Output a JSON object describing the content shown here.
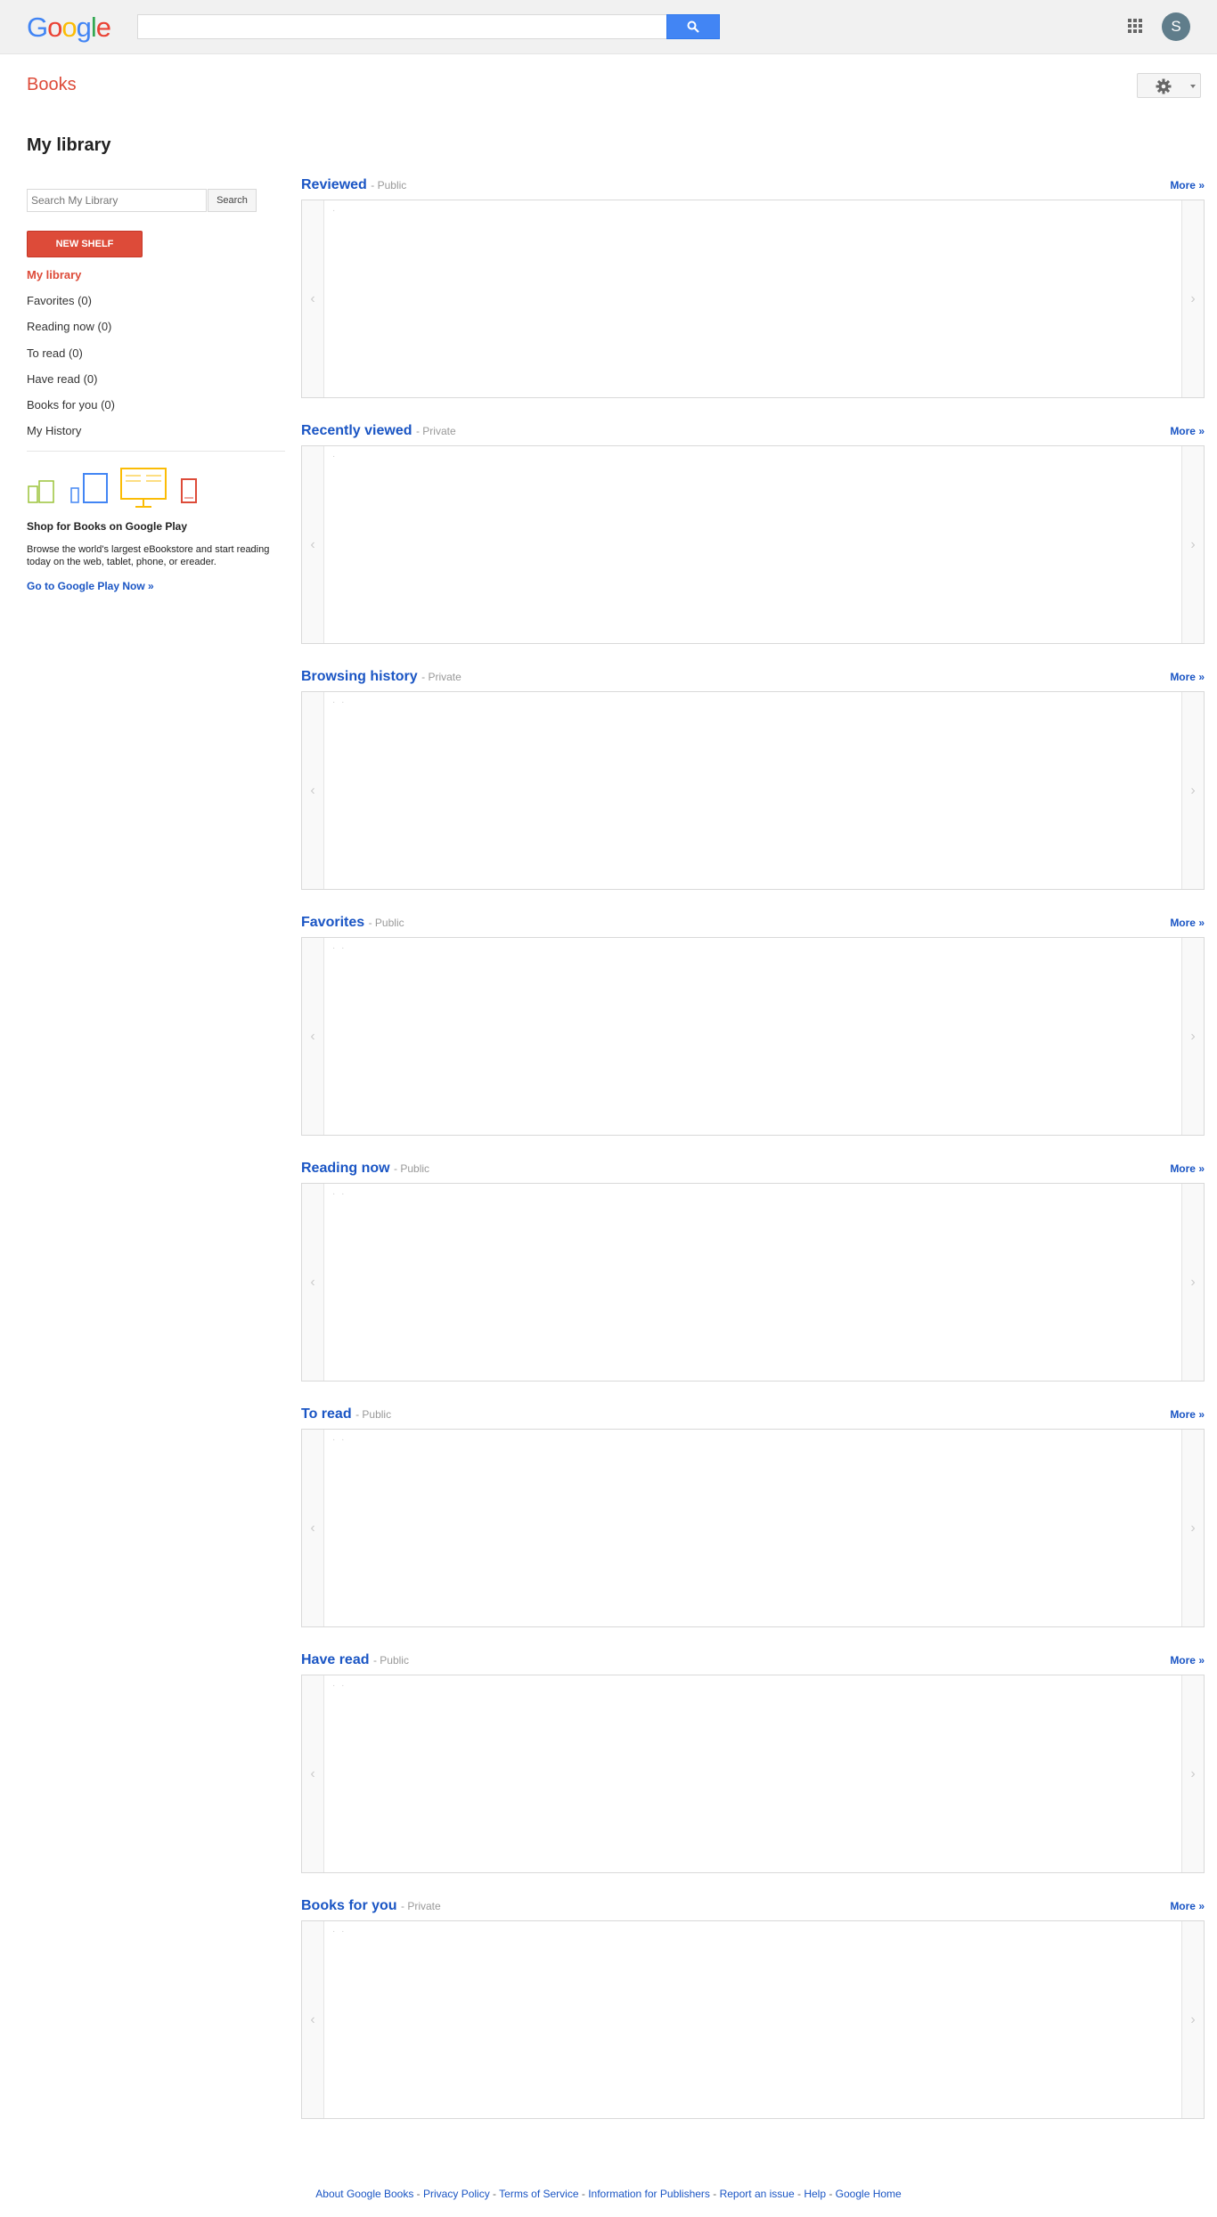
{
  "header": {
    "logo": [
      "G",
      "o",
      "o",
      "g",
      "l",
      "e"
    ],
    "search_placeholder": "",
    "avatar_letter": "S"
  },
  "books": {
    "title": "Books"
  },
  "page_title": "My library",
  "library_search": {
    "placeholder": "Search My Library",
    "button_label": "Search"
  },
  "new_shelf_label": "NEW SHELF",
  "shelf_nav": [
    "My library",
    "Favorites (0)",
    "Reading now (0)",
    "To read (0)",
    "Have read (0)",
    "Books for you (0)",
    "My History"
  ],
  "promo": {
    "title": "Shop for Books on Google Play",
    "text": "Browse the world's largest eBookstore and start reading today on the web, tablet, phone, or ereader.",
    "link": "Go to Google Play Now »"
  },
  "shelves": [
    {
      "name": "Reviewed",
      "visibility": "- Public",
      "more": "More »",
      "dots": "·"
    },
    {
      "name": "Recently viewed",
      "visibility": "- Private",
      "more": "More »",
      "dots": "·"
    },
    {
      "name": "Browsing history",
      "visibility": "- Private",
      "more": "More »",
      "dots": "· ·"
    },
    {
      "name": "Favorites",
      "visibility": "- Public",
      "more": "More »",
      "dots": "· ·"
    },
    {
      "name": "Reading now",
      "visibility": "- Public",
      "more": "More »",
      "dots": "· ·"
    },
    {
      "name": "To read",
      "visibility": "- Public",
      "more": "More »",
      "dots": "· ·"
    },
    {
      "name": "Have read",
      "visibility": "- Public",
      "more": "More »",
      "dots": "· ·"
    },
    {
      "name": "Books for you",
      "visibility": "- Private",
      "more": "More »",
      "dots": "· ·"
    }
  ],
  "carousel": {
    "prev": "‹",
    "next": "›"
  },
  "footer": {
    "links": [
      "About Google Books",
      "Privacy Policy",
      "Terms of Service",
      "Information for Publishers",
      "Report an issue",
      "Help",
      "Google Home"
    ],
    "separator": " - "
  },
  "colors": {
    "accent_red": "#dd4b39",
    "link_blue": "#1a55c4",
    "search_blue": "#4285f4"
  }
}
